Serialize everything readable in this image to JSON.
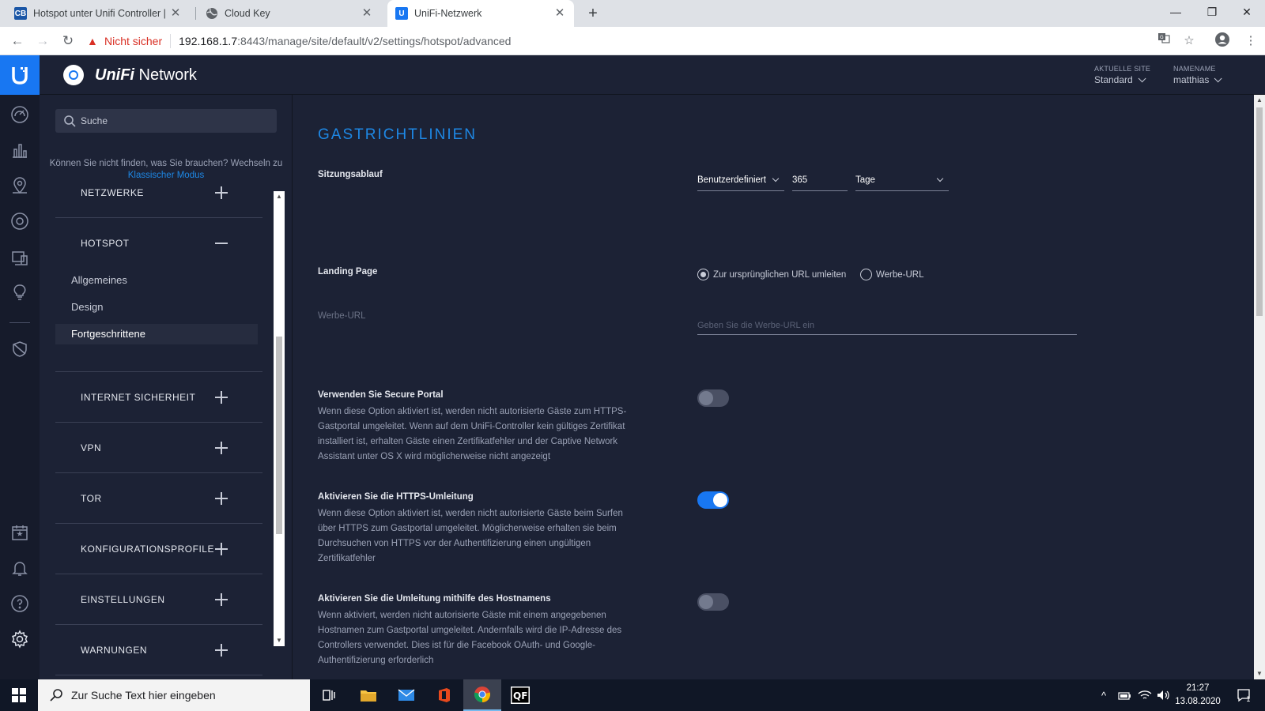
{
  "browser": {
    "tabs": [
      {
        "title": "Hotspot unter Unifi Controller | C",
        "favicon": "CB",
        "favicon_color": "#1a56a6"
      },
      {
        "title": "Cloud Key",
        "favicon": "globe-icon"
      },
      {
        "title": "UniFi-Netzwerk",
        "favicon": "U",
        "favicon_color": "#1877f2",
        "active": true
      }
    ],
    "not_secure": "Nicht sicher",
    "url_host": "192.168.1.7",
    "url_path": ":8443/manage/site/default/v2/settings/hotspot/advanced"
  },
  "header": {
    "brand_bold": "UniFi",
    "brand_rest": " Network",
    "site_label": "AKTUELLE SITE",
    "site_value": "Standard",
    "user_label": "NAMENAME",
    "user_value": "matthias"
  },
  "sidepanel": {
    "search_placeholder": "Suche",
    "hint_text": "Können Sie nicht finden, was Sie brauchen? Wechseln zu",
    "hint_link": "Klassischer Modus",
    "sections": [
      {
        "label": "NETZWERKE",
        "expanded": false
      },
      {
        "label": "HOTSPOT",
        "expanded": true
      },
      {
        "label": "INTERNET SICHERHEIT",
        "expanded": false
      },
      {
        "label": "VPN",
        "expanded": false
      },
      {
        "label": "TOR",
        "expanded": false
      },
      {
        "label": "KONFIGURATIONSPROFILE",
        "expanded": false
      },
      {
        "label": "EINSTELLUNGEN",
        "expanded": false
      },
      {
        "label": "WARNUNGEN",
        "expanded": false
      }
    ],
    "hotspot_items": [
      "Allgemeines",
      "Design",
      "Fortgeschrittene"
    ],
    "active_item": "Fortgeschrittene"
  },
  "main": {
    "title": "GASTRICHTLINIEN",
    "session": {
      "label": "Sitzungsablauf",
      "mode": "Benutzerdefiniert",
      "value": "365",
      "unit": "Tage"
    },
    "landing": {
      "label": "Landing Page",
      "option_original": "Zur ursprünglichen URL umleiten",
      "option_promo": "Werbe-URL",
      "selected": "original"
    },
    "promo_url": {
      "label": "Werbe-URL",
      "placeholder": "Geben Sie die Werbe-URL ein"
    },
    "toggles": [
      {
        "label": "Verwenden Sie Secure Portal",
        "desc": "Wenn diese Option aktiviert ist, werden nicht autorisierte Gäste zum HTTPS-Gastportal umgeleitet. Wenn auf dem UniFi-Controller kein gültiges Zertifikat installiert ist, erhalten Gäste einen Zertifikatfehler und der Captive Network Assistant unter OS X wird möglicherweise nicht angezeigt",
        "enabled": false
      },
      {
        "label": "Aktivieren Sie die HTTPS-Umleitung",
        "desc": "Wenn diese Option aktiviert ist, werden nicht autorisierte Gäste beim Surfen über HTTPS zum Gastportal umgeleitet. Möglicherweise erhalten sie beim Durchsuchen von HTTPS vor der Authentifizierung einen ungültigen Zertifikatfehler",
        "enabled": true
      },
      {
        "label": "Aktivieren Sie die Umleitung mithilfe des Hostnamens",
        "desc": "Wenn aktiviert, werden nicht autorisierte Gäste mit einem angegebenen Hostnamen zum Gastportal umgeleitet. Andernfalls wird die IP-Adresse des Controllers verwendet. Dies ist für die Facebook OAuth- und Google-Authentifizierung erforderlich",
        "enabled": false
      }
    ]
  },
  "taskbar": {
    "search_placeholder": "Zur Suche Text hier eingeben",
    "time": "21:27",
    "date": "13.08.2020",
    "notification_count": "1"
  },
  "colors": {
    "accent": "#1e88e5",
    "toggle_on": "#1877f2",
    "background": "#1c2235",
    "rail": "#161b2b"
  }
}
